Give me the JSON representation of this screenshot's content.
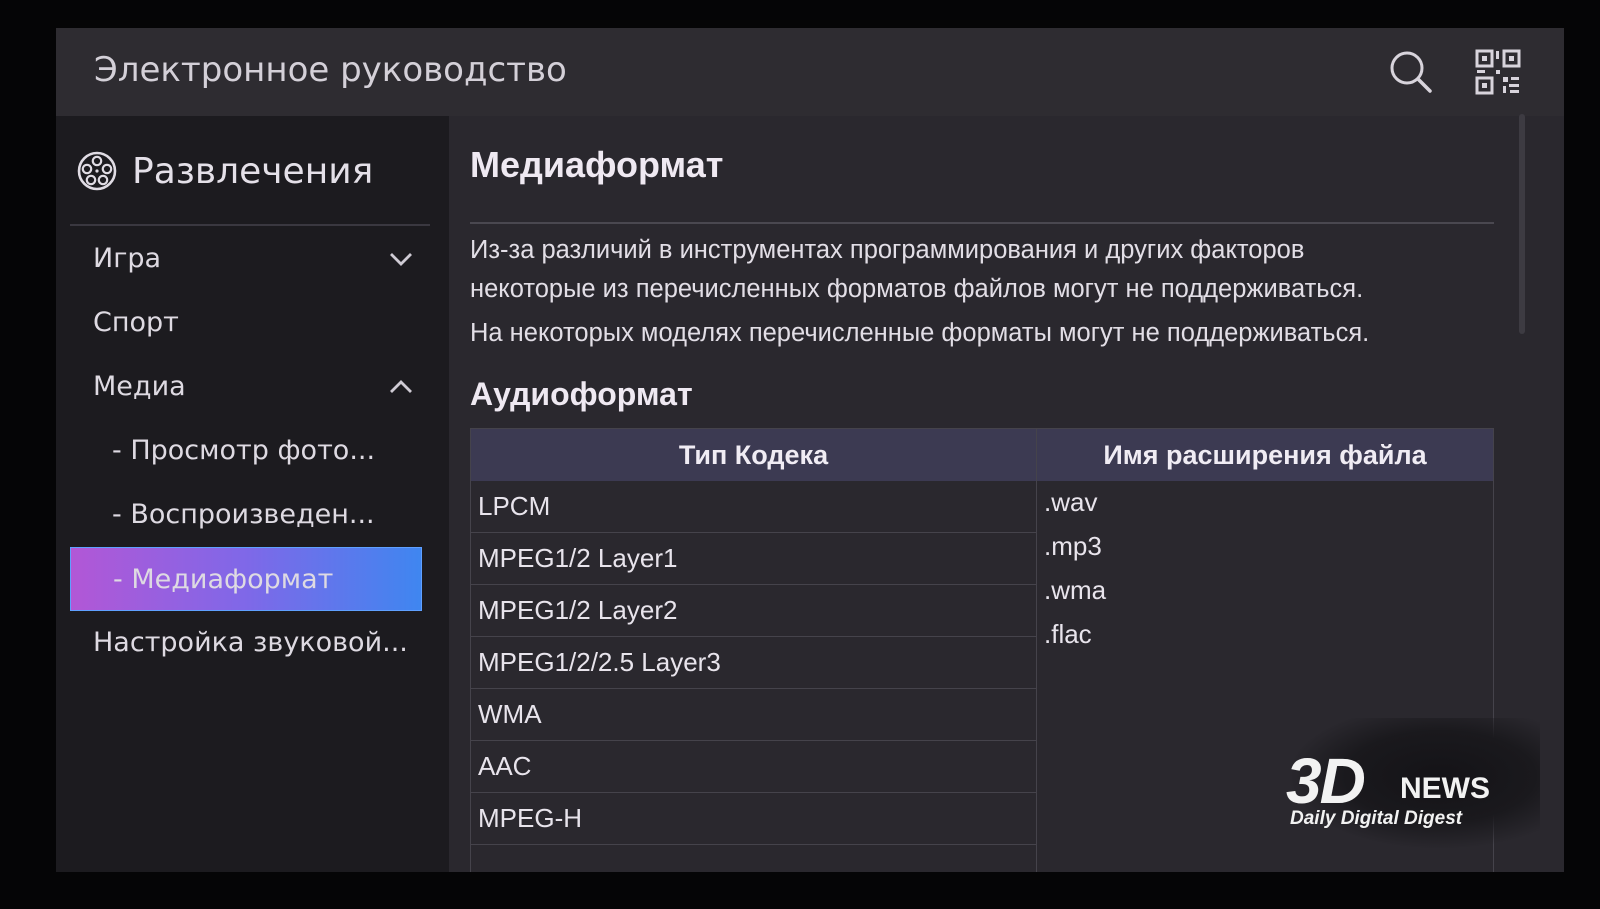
{
  "header": {
    "title": "Электронное руководство",
    "search_icon": "search-icon",
    "qr_icon": "qr-code-icon"
  },
  "sidebar": {
    "category": {
      "icon": "film-reel-icon",
      "label": "Развлечения"
    },
    "items": [
      {
        "label": "Игра",
        "chevron": "chevron-down-icon"
      },
      {
        "label": "Спорт"
      },
      {
        "label": "Медиа",
        "chevron": "chevron-up-icon"
      },
      {
        "label": "- Просмотр фото..."
      },
      {
        "label": "- Воспроизведен..."
      },
      {
        "label": "- Медиаформат",
        "active": true
      },
      {
        "label": "Настройка звуковой..."
      }
    ]
  },
  "main": {
    "title": "Медиаформат",
    "paragraphs": [
      "Из-за различий в инструментах программирования и других факторов",
      "некоторые из перечисленных форматов файлов могут не поддерживаться.",
      "На некоторых моделях перечисленные форматы могут не поддерживаться."
    ],
    "section_title": "Аудиоформат",
    "table": {
      "headers": [
        "Тип Кодека",
        "Имя расширения файла"
      ],
      "codecs": [
        "LPCM",
        "MPEG1/2 Layer1",
        "MPEG1/2 Layer2",
        "MPEG1/2/2.5 Layer3",
        "WMA",
        "AAC",
        "MPEG-H"
      ],
      "extensions": [
        ".wav",
        ".mp3",
        ".wma",
        ".flac"
      ]
    }
  },
  "watermark": {
    "logo": "3D",
    "brand": "NEWS",
    "tagline": "Daily Digital Digest"
  },
  "colors": {
    "active_gradient_start": "#b257d6",
    "active_gradient_end": "#3f86f0",
    "table_header_bg": "#3c3a52"
  }
}
